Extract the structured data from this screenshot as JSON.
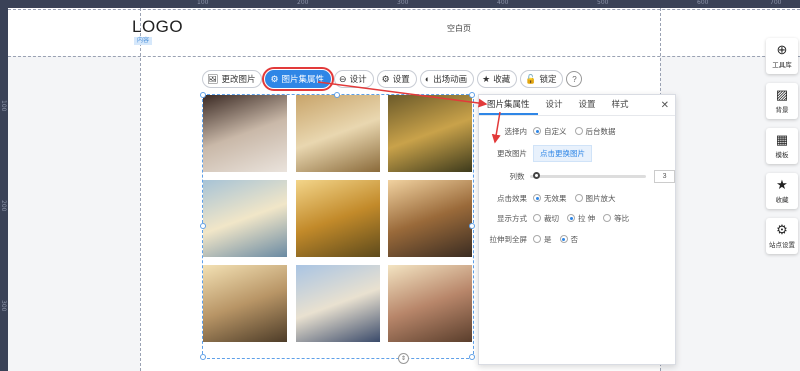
{
  "rulers": {
    "top_numbers": [
      "100",
      "200",
      "300",
      "400",
      "500",
      "600",
      "700"
    ],
    "left_numbers": [
      "100",
      "200",
      "300"
    ]
  },
  "header": {
    "logo_text": "LOGO",
    "logo_tag": "内容",
    "page_title": "空白页"
  },
  "toolbar": {
    "items": [
      {
        "label": "更改图片",
        "icon": "image-icon"
      },
      {
        "label": "图片集属性",
        "icon": "gear-icon"
      },
      {
        "label": "设计",
        "icon": "design-icon"
      },
      {
        "label": "设置",
        "icon": "settings-icon"
      },
      {
        "label": "出场动画",
        "icon": "animation-icon"
      },
      {
        "label": "收藏",
        "icon": "star-icon"
      },
      {
        "label": "锁定",
        "icon": "lock-icon"
      }
    ],
    "help": "?"
  },
  "gallery": {
    "photos": [
      {
        "name": "women-with-phones",
        "colors": [
          "#3b2a24",
          "#c9b8a8",
          "#eae3dc"
        ]
      },
      {
        "name": "wheat-field",
        "colors": [
          "#c8a46a",
          "#e9d7b0",
          "#8a6a3a"
        ]
      },
      {
        "name": "golden-grass",
        "colors": [
          "#6b5a2a",
          "#c9a24a",
          "#3d3a1c"
        ]
      },
      {
        "name": "dandelion-blue",
        "colors": [
          "#a7c3d6",
          "#f1e6c8",
          "#6a8aa3"
        ]
      },
      {
        "name": "lone-tree",
        "colors": [
          "#f3d58a",
          "#c28a2a",
          "#5d4a1c"
        ]
      },
      {
        "name": "sunset-path",
        "colors": [
          "#f1d2a0",
          "#9a6a3a",
          "#3a2c22"
        ]
      },
      {
        "name": "fence-sunset",
        "colors": [
          "#f3e1b4",
          "#b89566",
          "#4d3c28"
        ]
      },
      {
        "name": "pier-sky",
        "colors": [
          "#a9c4e3",
          "#e9e1d0",
          "#3a4a6a"
        ]
      },
      {
        "name": "city-street",
        "colors": [
          "#f3e4c2",
          "#b8866a",
          "#5a3e2c"
        ]
      }
    ],
    "handle_glyph": "⇕"
  },
  "panel": {
    "tabs": [
      "图片集属性",
      "设计",
      "设置",
      "样式"
    ],
    "close": "✕",
    "rows": {
      "source": {
        "label": "选择内",
        "options": [
          "自定义",
          "后台数据"
        ],
        "selected": 0
      },
      "change": {
        "label": "更改图片",
        "button": "点击更换图片"
      },
      "columns": {
        "label": "列数",
        "value": "3",
        "level": 0.03
      },
      "click": {
        "label": "点击效果",
        "options": [
          "无效果",
          "图片放大"
        ],
        "selected": 0
      },
      "display": {
        "label": "显示方式",
        "options": [
          "裁切",
          "拉 伸",
          "等比"
        ],
        "selected": 1
      },
      "fullscreen": {
        "label": "拉伸到全屏",
        "options": [
          "是",
          "否"
        ],
        "selected": 1
      }
    }
  },
  "sidebar": {
    "items": [
      {
        "label": "工具库",
        "icon": "plus-icon"
      },
      {
        "label": "背景",
        "icon": "background-icon"
      },
      {
        "label": "模板",
        "icon": "template-icon"
      },
      {
        "label": "收藏",
        "icon": "star-icon"
      },
      {
        "label": "站点设置",
        "icon": "gears-icon"
      }
    ]
  },
  "colors": {
    "accent": "#2f86e6",
    "highlight": "#e23a3a",
    "background": "#2d3446"
  }
}
